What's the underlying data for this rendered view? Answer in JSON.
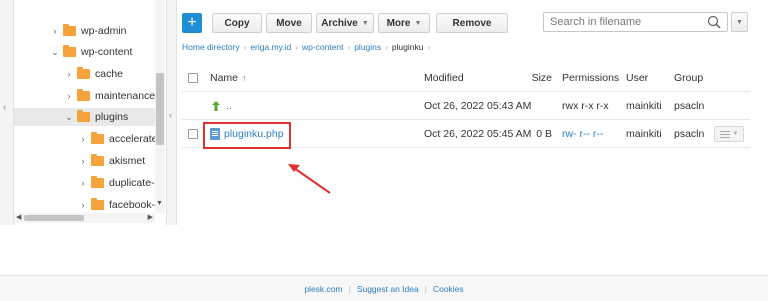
{
  "tree": {
    "items": [
      {
        "label": "wp-admin",
        "expanded": false
      },
      {
        "label": "wp-content",
        "expanded": true
      },
      {
        "label": "cache",
        "expanded": false
      },
      {
        "label": "maintenance",
        "expanded": false
      },
      {
        "label": "plugins",
        "expanded": true
      },
      {
        "label": "accelerated",
        "expanded": false
      },
      {
        "label": "akismet",
        "expanded": false
      },
      {
        "label": "duplicate-p",
        "expanded": false
      },
      {
        "label": "facebook-fe",
        "expanded": false
      }
    ]
  },
  "toolbar": {
    "add_label": "+",
    "copy_label": "Copy",
    "move_label": "Move",
    "archive_label": "Archive",
    "more_label": "More",
    "remove_label": "Remove"
  },
  "search": {
    "placeholder": "Search in filename"
  },
  "breadcrumb": {
    "items": [
      "Home directory",
      "eriga.my.id",
      "wp-content",
      "plugins"
    ],
    "current": "pluginku"
  },
  "table": {
    "headers": {
      "name": "Name",
      "modified": "Modified",
      "size": "Size",
      "permissions": "Permissions",
      "user": "User",
      "group": "Group"
    },
    "rows": [
      {
        "name": "..",
        "modified": "Oct 26, 2022 05:43 AM",
        "size": "",
        "permissions": "rwx r-x r-x",
        "user": "mainkiti",
        "group": "psacln"
      },
      {
        "name": "pluginku.php",
        "modified": "Oct 26, 2022 05:45 AM",
        "size": "0 B",
        "permissions": "rw- r-- r--",
        "user": "mainkiti",
        "group": "psacln"
      }
    ]
  },
  "footer": {
    "links": [
      "plesk.com",
      "Suggest an Idea",
      "Cookies"
    ]
  },
  "colors": {
    "accent": "#1e8fd5",
    "link": "#2c7fc1",
    "folder": "#f5a23a",
    "highlight": "#e03030"
  }
}
